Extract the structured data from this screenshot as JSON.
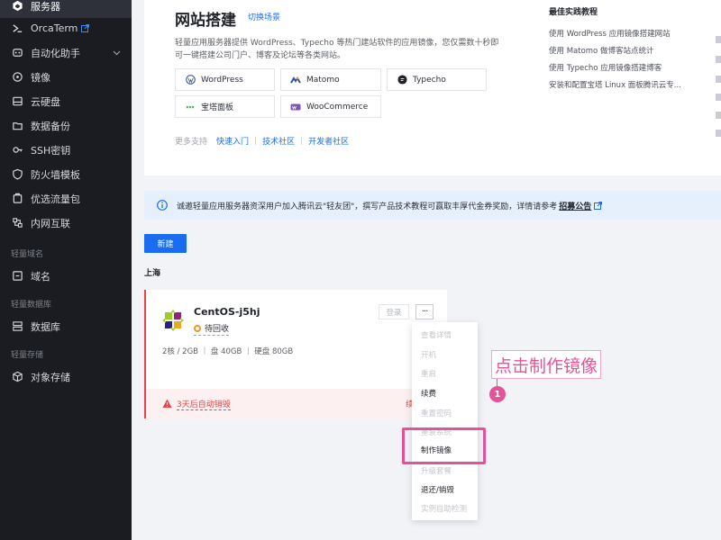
{
  "sidebar": {
    "items": [
      {
        "label": "服务器",
        "icon": "server-icon"
      },
      {
        "label": "OrcaTerm",
        "icon": "terminal-icon"
      },
      {
        "label": "自动化助手",
        "icon": "automation-icon"
      },
      {
        "label": "镜像",
        "icon": "image-icon"
      },
      {
        "label": "云硬盘",
        "icon": "disk-icon"
      },
      {
        "label": "数据备份",
        "icon": "backup-icon"
      },
      {
        "label": "SSH密钥",
        "icon": "key-icon"
      },
      {
        "label": "防火墙模板",
        "icon": "shield-icon"
      },
      {
        "label": "优选流量包",
        "icon": "traffic-icon"
      },
      {
        "label": "内网互联",
        "icon": "network-icon"
      },
      {
        "label": "域名",
        "icon": "domain-icon"
      },
      {
        "label": "数据库",
        "icon": "database-icon"
      },
      {
        "label": "对象存储",
        "icon": "storage-icon"
      }
    ],
    "groups": {
      "domain": "轻量域名",
      "database": "轻量数据库",
      "storage": "轻量存储"
    }
  },
  "site": {
    "title": "网站搭建",
    "switch_link": "切换场景",
    "desc": "轻量应用服务器提供 WordPress、Typecho 等热门建站软件的应用镜像，您仅需数十秒即可一键搭建公司门户、博客及论坛等各类网站。",
    "apps": [
      "WordPress",
      "Matomo",
      "Typecho",
      "宝塔面板",
      "WooCommerce"
    ],
    "more_label": "更多支持",
    "links": [
      "快速入门",
      "技术社区",
      "开发者社区"
    ]
  },
  "best_practices": {
    "title": "最佳实践教程",
    "items": [
      "使用 WordPress 应用镜像搭建网站",
      "使用 Matomo 做博客站点统计",
      "使用 Typecho 应用镜像搭建博客",
      "安装和配置宝塔 Linux 面板腾讯云专..."
    ]
  },
  "notice": {
    "text": "诚邀轻量应用服务器资深用户加入腾讯云\"轻友团\"，撰写产品技术教程可赢取丰厚代金券奖励，详情请参考",
    "link": "招募公告"
  },
  "new_button": "新建",
  "region": "上海",
  "instance": {
    "name": "CentOS-j5hj",
    "status": "待回收",
    "spec": "2核 / 2GB ｜ 盘 40GB ｜ 硬盘 80GB",
    "login": "登录",
    "more": "···",
    "warning": "3天后自动销毁",
    "renew": "续"
  },
  "menu": {
    "items": [
      {
        "label": "查看详情",
        "enabled": false
      },
      {
        "label": "开机",
        "enabled": false
      },
      {
        "label": "重启",
        "enabled": false
      },
      {
        "label": "续费",
        "enabled": true
      },
      {
        "label": "重置密码",
        "enabled": false
      },
      {
        "label": "重装系统",
        "enabled": false
      },
      {
        "label": "制作镜像",
        "enabled": true
      },
      {
        "label": "升级套餐",
        "enabled": false
      },
      {
        "label": "退还/销毁",
        "enabled": true
      },
      {
        "label": "实例自助检测",
        "enabled": false
      }
    ]
  },
  "annotation": {
    "text": "点击制作镜像",
    "step": "1"
  },
  "colors": {
    "accent": "#1a6cf0",
    "sidebar_bg": "#1a1c22",
    "danger": "#e54545",
    "annotation": "#e5529a",
    "pending": "#f0952a"
  }
}
